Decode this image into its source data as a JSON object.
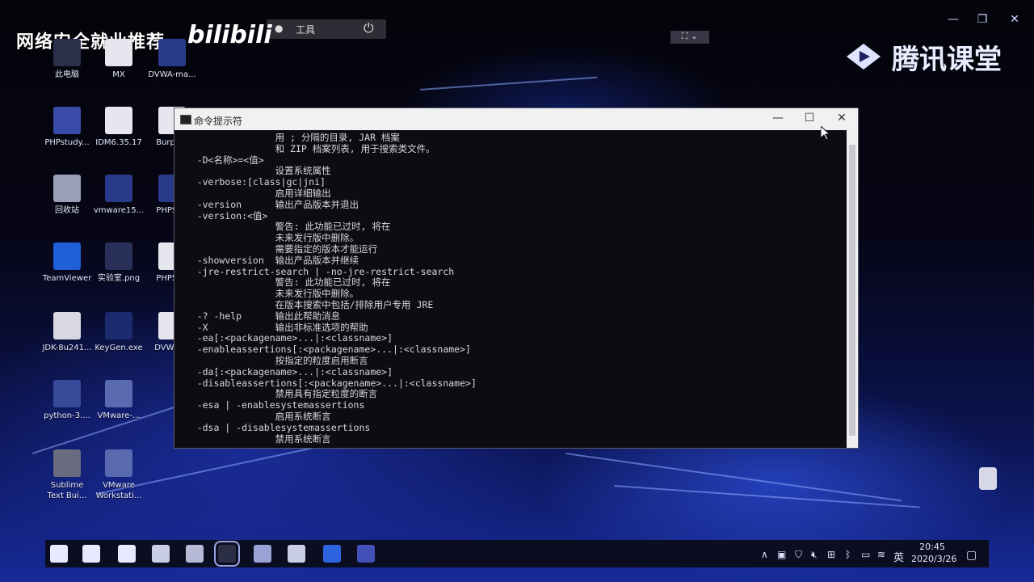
{
  "overlay": {
    "watermark": "网络安全就业推荐",
    "bilibili": "bilibili",
    "rec_label": "工具",
    "tencent": "腾讯课堂"
  },
  "desktop_icons": [
    {
      "label": "此电脑",
      "icon": "computer-icon",
      "color": "#2b2f4a"
    },
    {
      "label": "MX",
      "icon": "file-icon",
      "color": "#e6e6ee"
    },
    {
      "label": "DVWA-ma...",
      "icon": "zip-icon",
      "color": "#2a3a8a"
    },
    {
      "label": "PHPstudy...",
      "icon": "phpstudy-icon",
      "color": "#3a4aa8"
    },
    {
      "label": "IDM6.35.17",
      "icon": "file-icon",
      "color": "#e6e6ee"
    },
    {
      "label": "BurpS...",
      "icon": "file-icon",
      "color": "#e6e6ee"
    },
    {
      "label": "回收站",
      "icon": "recycle-bin-icon",
      "color": "#9aa0b8"
    },
    {
      "label": "vmware15...",
      "icon": "zip-icon",
      "color": "#2a3a8a"
    },
    {
      "label": "PHPSt...",
      "icon": "zip-icon",
      "color": "#2a3a8a"
    },
    {
      "label": "TeamViewer",
      "icon": "teamviewer-icon",
      "color": "#1f5fd8"
    },
    {
      "label": "实验室.png",
      "icon": "image-icon",
      "color": "#28305a"
    },
    {
      "label": "PHPSt...",
      "icon": "file-icon",
      "color": "#e6e6ee"
    },
    {
      "label": "JDK-8u241...",
      "icon": "java-icon",
      "color": "#d8d8e4"
    },
    {
      "label": "KeyGen.exe",
      "icon": "key-icon",
      "color": "#1c2a70"
    },
    {
      "label": "DVWA-...",
      "icon": "file-icon",
      "color": "#e6e6ee"
    },
    {
      "label": "python-3....",
      "icon": "python-icon",
      "color": "#3a4a9a"
    },
    {
      "label": "VMware-...",
      "icon": "vmware-icon",
      "color": "#5a6ab0"
    },
    {
      "label": "Sublime\nText Bui...",
      "icon": "sublime-icon",
      "color": "#6a6a80"
    },
    {
      "label": "VMware\nWorkstati...",
      "icon": "vmware-icon",
      "color": "#5a6ab0"
    }
  ],
  "cmd": {
    "title": "命令提示符",
    "minimize": "—",
    "maximize": "☐",
    "close": "✕",
    "lines": [
      "                  用 ; 分隔的目录, JAR 档案",
      "                  和 ZIP 档案列表, 用于搜索类文件。",
      "    -D<名称>=<值>",
      "                  设置系统属性",
      "    -verbose:[class|gc|jni]",
      "                  启用详细输出",
      "    -version      输出产品版本并退出",
      "    -version:<值>",
      "                  警告: 此功能已过时, 将在",
      "                  未来发行版中删除。",
      "                  需要指定的版本才能运行",
      "    -showversion  输出产品版本并继续",
      "    -jre-restrict-search | -no-jre-restrict-search",
      "                  警告: 此功能已过时, 将在",
      "                  未来发行版中删除。",
      "                  在版本搜索中包括/排除用户专用 JRE",
      "    -? -help      输出此帮助消息",
      "    -X            输出非标准选项的帮助",
      "    -ea[:<packagename>...|:<classname>]",
      "    -enableassertions[:<packagename>...|:<classname>]",
      "                  按指定的粒度启用断言",
      "    -da[:<packagename>...|:<classname>]",
      "    -disableassertions[:<packagename>...|:<classname>]",
      "                  禁用具有指定粒度的断言",
      "    -esa | -enablesystemassertions",
      "                  启用系统断言",
      "    -dsa | -disablesystemassertions",
      "                  禁用系统断言"
    ]
  },
  "taskbar": {
    "apps": [
      {
        "icon": "windows-start-icon",
        "color": "#e6e9ff"
      },
      {
        "icon": "search-icon",
        "color": "#e6e9ff"
      },
      {
        "icon": "task-view-icon",
        "color": "#e6e9ff"
      },
      {
        "icon": "chrome-icon",
        "color": "#c9cde6"
      },
      {
        "icon": "notepad-icon",
        "color": "#b6bad6"
      },
      {
        "icon": "cmd-icon",
        "color": "#2b2f45"
      },
      {
        "icon": "vmware-icon",
        "color": "#9aa2d6"
      },
      {
        "icon": "screenshot-icon",
        "color": "#c9cde6"
      },
      {
        "icon": "teamviewer-icon",
        "color": "#2d63e0"
      },
      {
        "icon": "phpstudy-icon",
        "color": "#4350b8"
      }
    ],
    "ime": "英",
    "time": "20:45",
    "date": "2020/3/26"
  }
}
